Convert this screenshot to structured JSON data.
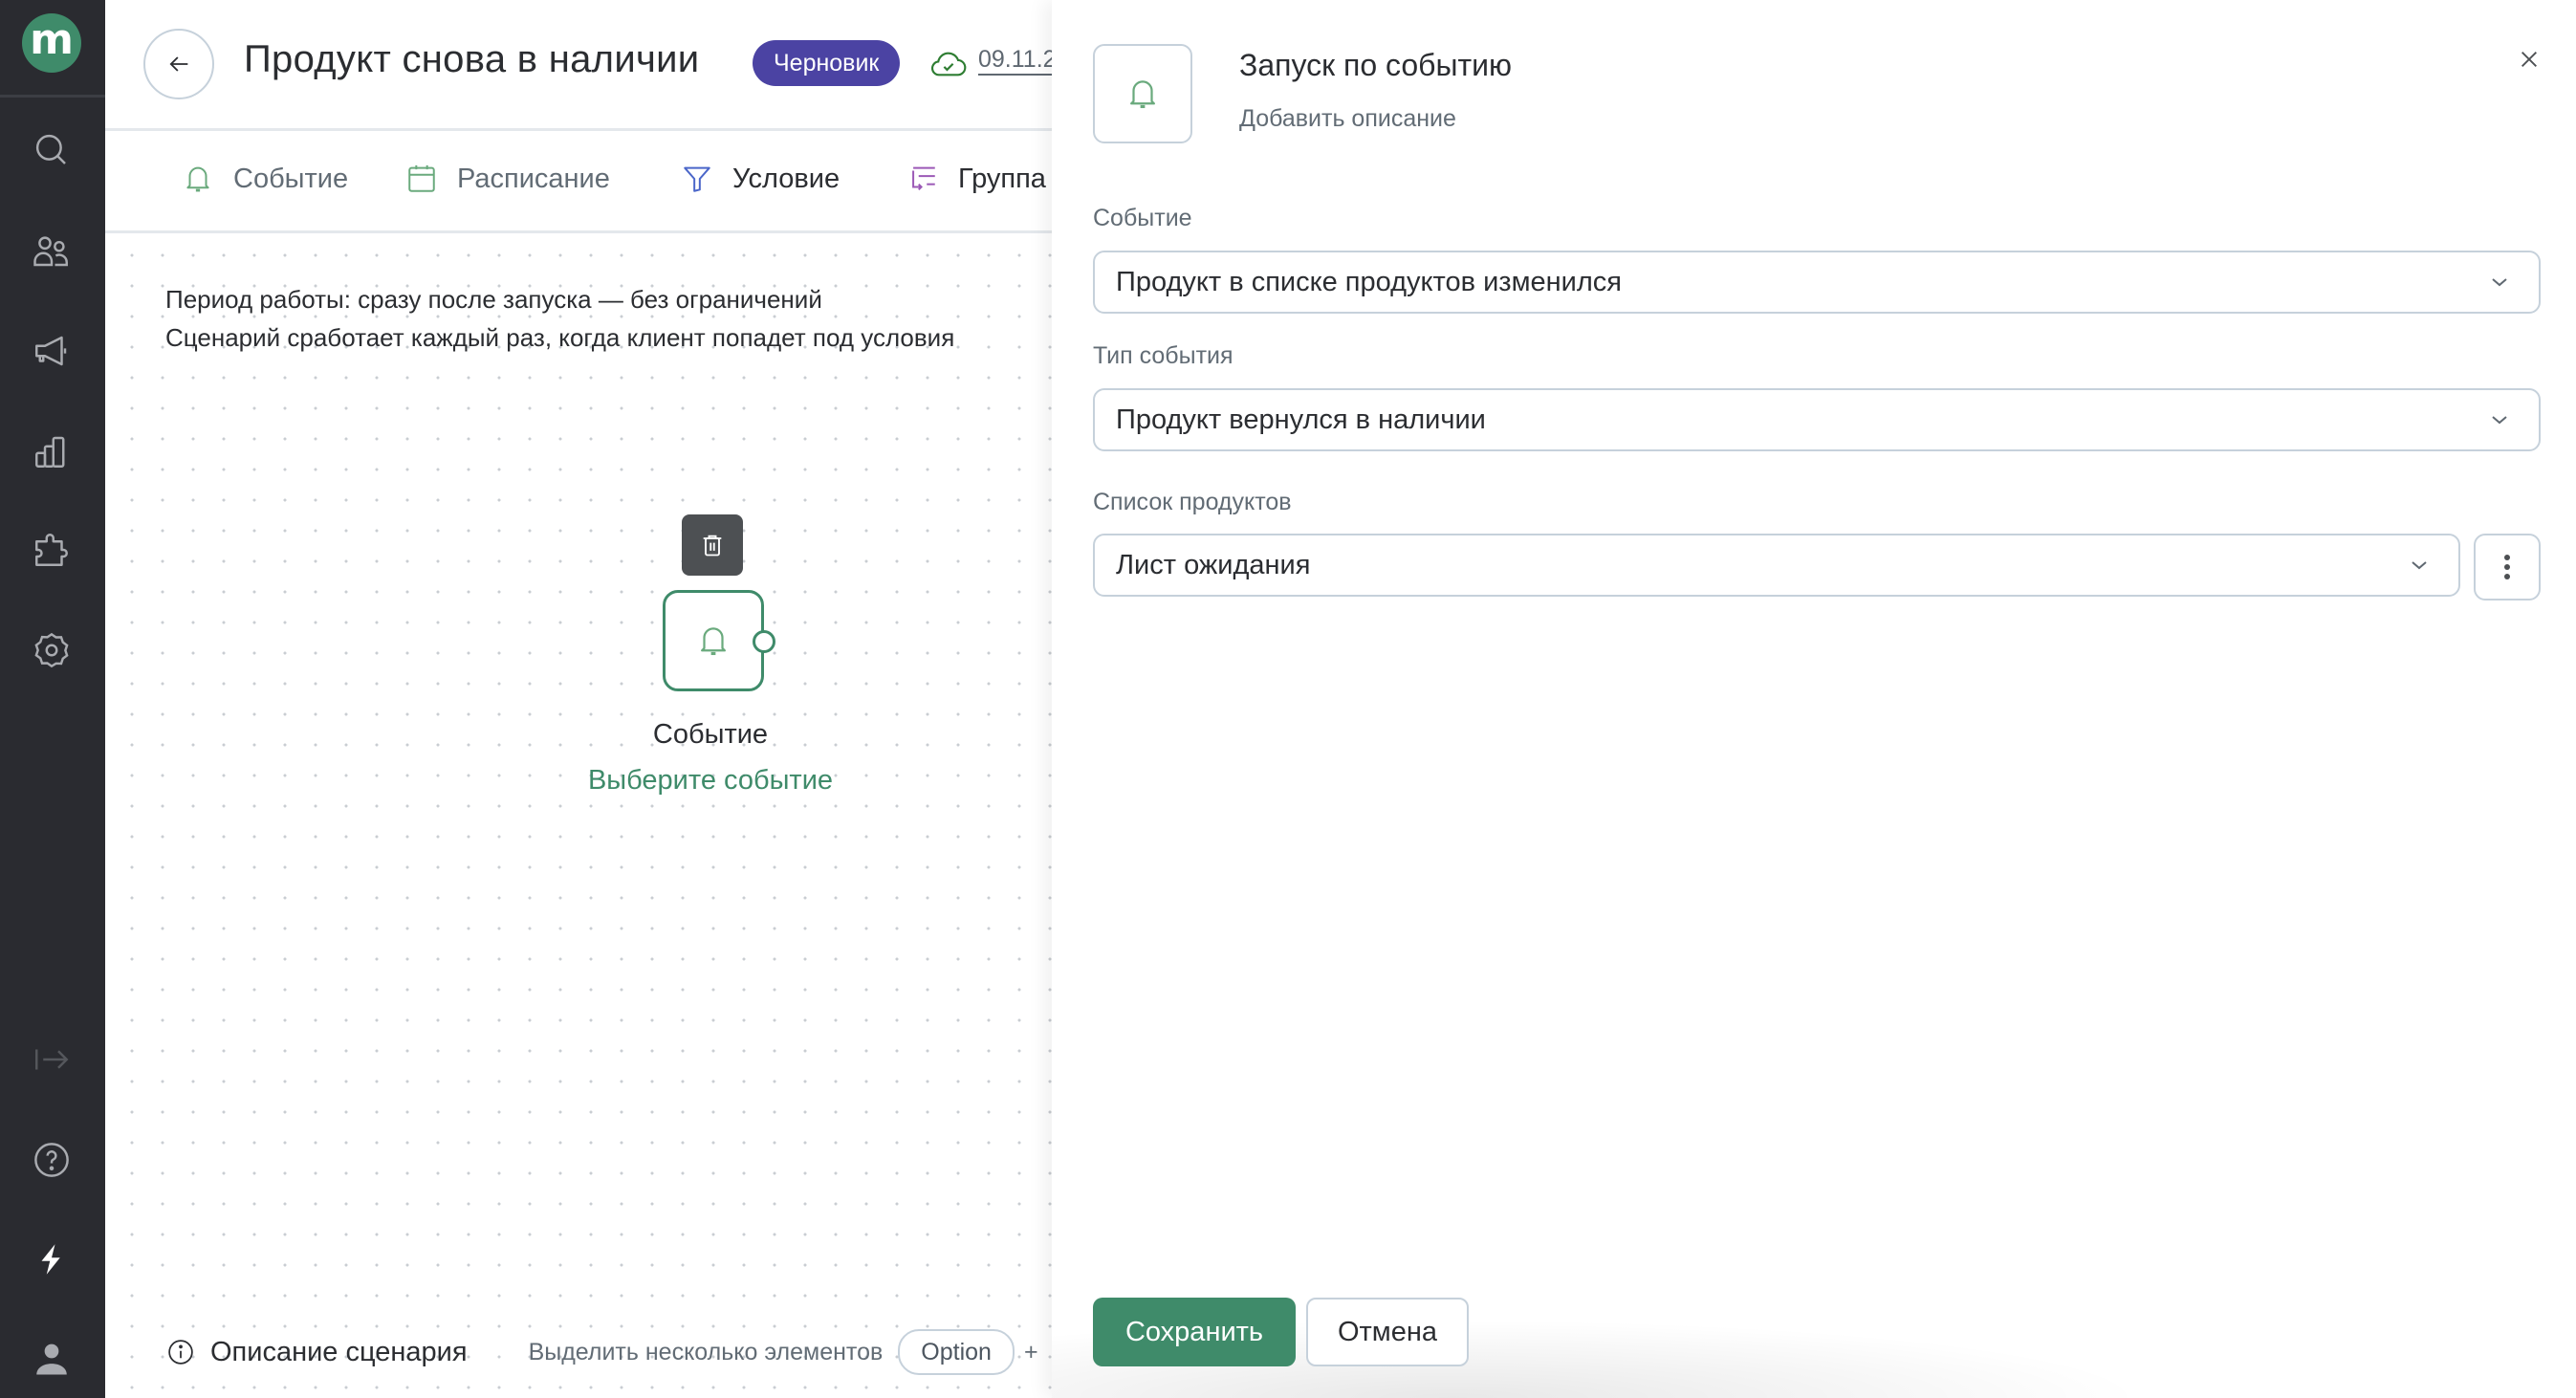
{
  "sidebar": {
    "logo_text": "m",
    "items": [
      {
        "name": "search",
        "icon": "search-icon"
      },
      {
        "name": "customers",
        "icon": "users-icon"
      },
      {
        "name": "campaigns",
        "icon": "megaphone-icon"
      },
      {
        "name": "analytics",
        "icon": "bar-chart-icon"
      },
      {
        "name": "integrations",
        "icon": "puzzle-icon"
      },
      {
        "name": "settings",
        "icon": "gear-icon"
      }
    ],
    "bottom_items": [
      {
        "name": "expand",
        "icon": "collapse-arrow-icon"
      },
      {
        "name": "help",
        "icon": "help-icon"
      },
      {
        "name": "whats-new",
        "icon": "lightning-icon"
      },
      {
        "name": "profile",
        "icon": "user-icon"
      }
    ]
  },
  "header": {
    "title": "Продукт снова в наличии",
    "status_badge": "Черновик",
    "saved_date": "09.11.2",
    "colors": {
      "badge": "#4b43a3",
      "accent": "#3f8b6a"
    }
  },
  "tabs": [
    {
      "label": "Событие",
      "icon": "bell-icon"
    },
    {
      "label": "Расписание",
      "icon": "calendar-icon"
    },
    {
      "label": "Условие",
      "icon": "filter-icon"
    },
    {
      "label": "Группа",
      "icon": "group-icon"
    }
  ],
  "canvas": {
    "info_line1": "Период работы: сразу после запуска — без ограничений",
    "info_line2": "Сценарий сработает каждый раз, когда клиент попадет под условия",
    "node": {
      "title": "Событие",
      "subtitle": "Выберите событие"
    },
    "bottom": {
      "description_link": "Описание сценария",
      "multi_select_hint": "Выделить несколько элементов",
      "key": "Option",
      "plus": "+"
    }
  },
  "panel": {
    "title": "Запуск по событию",
    "add_description": "Добавить описание",
    "fields": [
      {
        "label": "Событие",
        "value": "Продукт в списке продуктов изменился"
      },
      {
        "label": "Тип события",
        "value": "Продукт вернулся в наличии"
      },
      {
        "label": "Список продуктов",
        "value": "Лист ожидания"
      }
    ],
    "save_label": "Сохранить",
    "cancel_label": "Отмена"
  }
}
